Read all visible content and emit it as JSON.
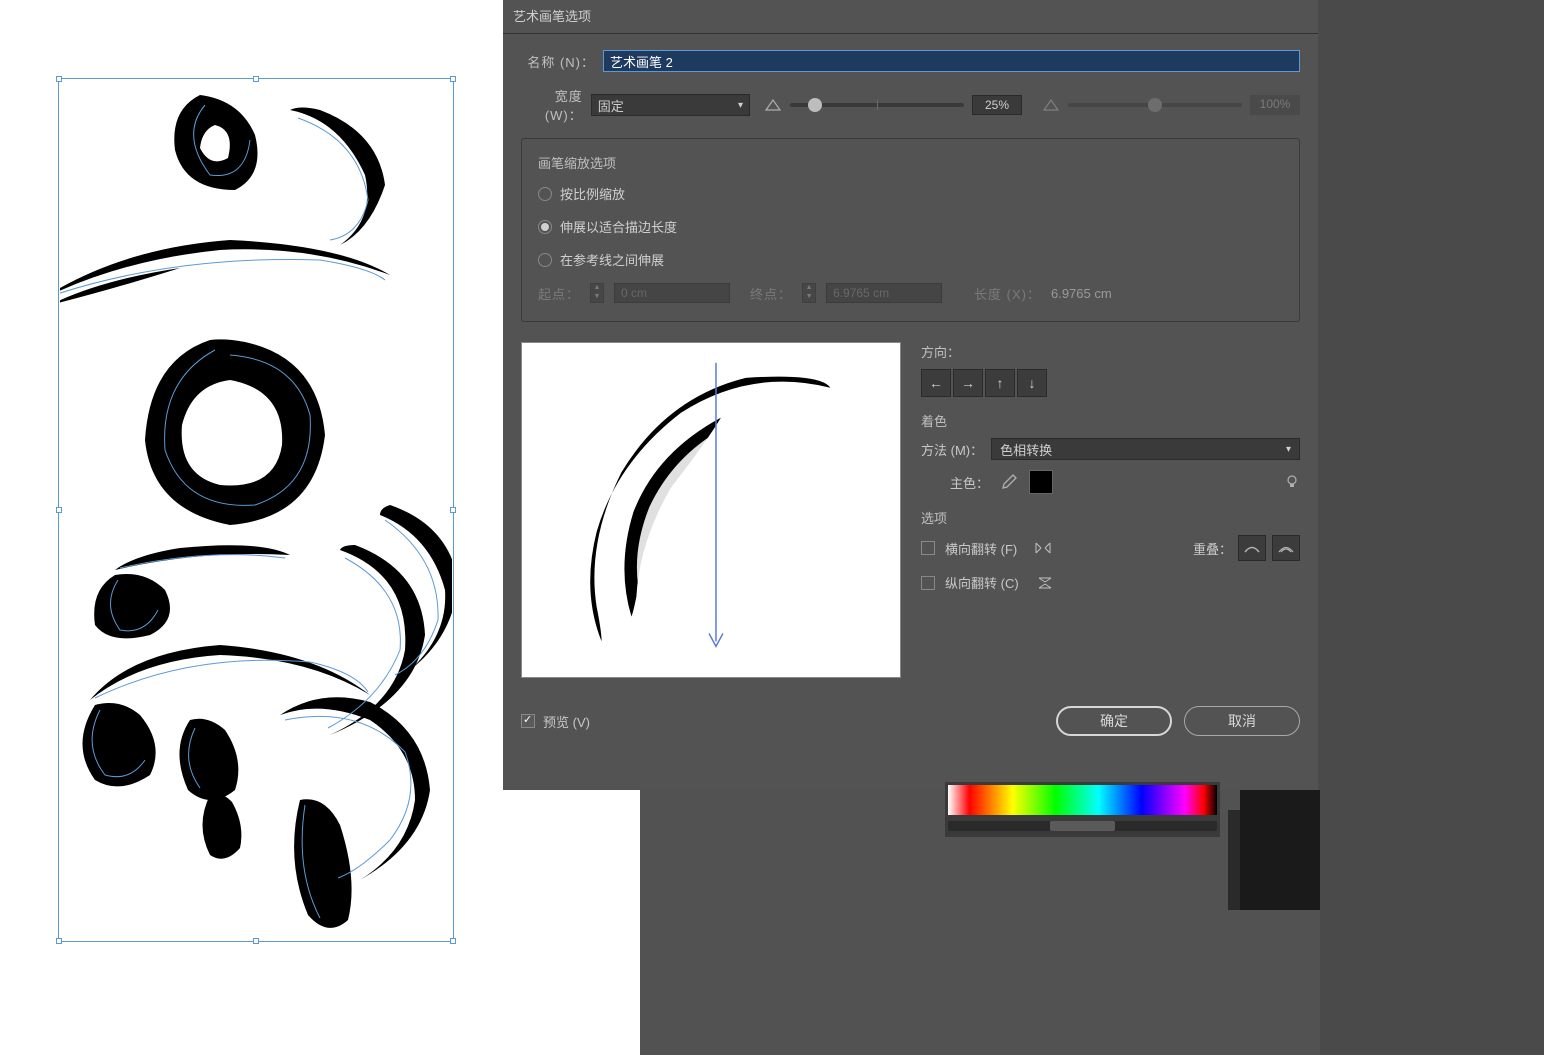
{
  "dialog": {
    "title": "艺术画笔选项",
    "name_label": "名称 (N)：",
    "name_value": "艺术画笔 2",
    "width_label": "宽度 (W)：",
    "width_mode": "固定",
    "width_pct": "25%",
    "width_pct2": "100%",
    "scale_group_title": "画笔缩放选项",
    "scale_opt1": "按比例缩放",
    "scale_opt2": "伸展以适合描边长度",
    "scale_opt3": "在参考线之间伸展",
    "start_label": "起点：",
    "start_value": "0 cm",
    "end_label": "终点：",
    "end_value": "6.9765 cm",
    "length_label": "长度 (X)：",
    "length_value": "6.9765 cm",
    "direction_label": "方向：",
    "colorize_label": "着色",
    "method_label": "方法 (M)：",
    "method_value": "色相转换",
    "keycolor_label": "主色：",
    "options_label": "选项",
    "flip_h": "横向翻转 (F)",
    "flip_v": "纵向翻转 (C)",
    "overlap_label": "重叠：",
    "preview_label": "预览 (V)",
    "ok": "确定",
    "cancel": "取消"
  }
}
